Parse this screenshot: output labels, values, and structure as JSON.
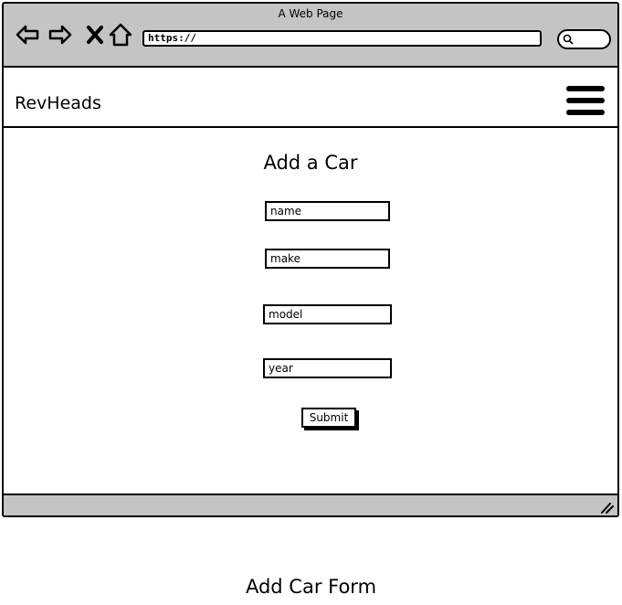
{
  "browser": {
    "title": "A Web Page",
    "url": "https://",
    "icons": [
      "back-arrow-icon",
      "forward-arrow-icon",
      "close-icon",
      "home-icon",
      "search-icon"
    ]
  },
  "navbar": {
    "brand": "RevHeads",
    "menu_icon": "hamburger-menu-icon"
  },
  "form": {
    "title": "Add a Car",
    "fields": {
      "name": "name",
      "make": "make",
      "model": "model",
      "year": "year"
    },
    "submit_label": "Submit"
  },
  "caption": "Add Car Form"
}
